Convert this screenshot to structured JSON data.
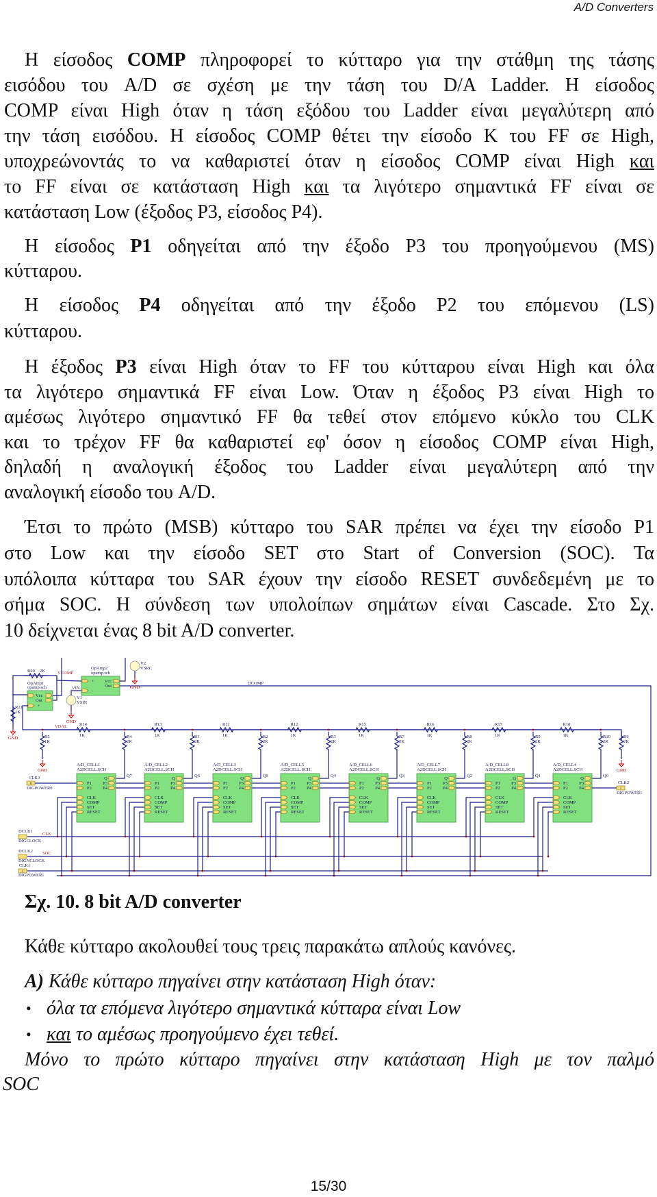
{
  "header": {
    "title": "A/D Converters"
  },
  "body": [
    {
      "lines": [
        [
          {
            "t": "Η είσοδος "
          },
          {
            "t": "COMP",
            "bold": true
          },
          {
            "t": " πληροφορεί το κύτταρο για την στάθμη της τάσης"
          }
        ],
        [
          {
            "t": "εισόδου του A/D σε σχέση με την τάση του D/A Ladder. Η είσοδος"
          }
        ],
        [
          {
            "t": "COMP είναι High όταν η τάση εξόδου του Ladder είναι μεγαλύτερη από"
          }
        ],
        [
          {
            "t": "την τάση εισόδου. Η είσοδος COMP θέτει την είσοδο K του FF σε High,"
          }
        ],
        [
          {
            "t": "υποχρεώνοντάς το να καθαριστεί όταν η είσοδος COMP είναι High "
          },
          {
            "t": "και",
            "underline": true
          }
        ],
        [
          {
            "t": "το FF είναι σε κατάσταση High "
          },
          {
            "t": "και",
            "underline": true
          },
          {
            "t": " τα λιγότερο σημαντικά FF είναι σε"
          }
        ],
        [
          {
            "t": "κατάσταση Low (έξοδος P3, είσοδος P4)."
          }
        ]
      ]
    },
    {
      "lines": [
        [
          {
            "t": "Η είσοδος "
          },
          {
            "t": "P1",
            "bold": true
          },
          {
            "t": " οδηγείται από την έξοδο P3 του προηγούμενου (MS)"
          }
        ],
        [
          {
            "t": "κύτταρου."
          }
        ]
      ]
    },
    {
      "lines": [
        [
          {
            "t": "Η είσοδος "
          },
          {
            "t": "P4",
            "bold": true
          },
          {
            "t": " οδηγείται από την έξοδο P2 του επόμενου (LS)"
          }
        ],
        [
          {
            "t": "κύτταρου."
          }
        ]
      ]
    },
    {
      "lines": [
        [
          {
            "t": "Η έξοδος "
          },
          {
            "t": "P3",
            "bold": true
          },
          {
            "t": " είναι High όταν το FF του κύτταρου είναι High και όλα"
          }
        ],
        [
          {
            "t": "τα λιγότερο σημαντικά FF είναι Low. Όταν η έξοδος P3 είναι High το"
          }
        ],
        [
          {
            "t": "αμέσως λιγότερο σημαντικό FF θα τεθεί στον επόμενο κύκλο του CLK"
          }
        ],
        [
          {
            "t": "και το τρέχον FF θα καθαριστεί εφ' όσον η είσοδος COMP είναι High,"
          }
        ],
        [
          {
            "t": "δηλαδή η αναλογική έξοδος του Ladder είναι μεγαλύτερη από την"
          }
        ],
        [
          {
            "t": "αναλογική είσοδο του A/D."
          }
        ]
      ]
    },
    {
      "lines": [
        [
          {
            "t": "Έτσι το πρώτο (MSB) κύτταρο του SAR πρέπει να έχει την είσοδο P1"
          }
        ],
        [
          {
            "t": "στο Low και την είσοδο SET στο Start of Conversion (SOC). Τα"
          }
        ],
        [
          {
            "t": "υπόλοιπα κύτταρα του SAR έχουν την είσοδο RESET συνδεδεμένη με το"
          }
        ],
        [
          {
            "t": "σήμα SOC. Η σύνδεση των υπολοίπων σημάτων είναι Cascade. Στο Σχ."
          }
        ],
        [
          {
            "t": "10 δείχνεται ένας 8 bit A/D converter."
          }
        ]
      ]
    },
    {
      "lines": [
        [
          {
            "t": "Σχ. 10. 8 bit A/D converter",
            "bold": true
          }
        ]
      ]
    },
    {
      "lines": [
        [
          {
            "t": "Κάθε κύτταρο ακολουθεί τους τρεις παρακάτω απλούς κανόνες."
          }
        ]
      ]
    },
    {
      "lines": [
        [
          {
            "t": "A)",
            "bold": true,
            "italic": true
          },
          {
            "t": " Κάθε κύτταρο πηγαίνει στην κατάσταση High όταν:",
            "italic": true
          }
        ]
      ]
    },
    {
      "lines": [
        [
          {
            "t": "όλα τα επόμενα λιγότερο σημαντικά κύτταρα είναι Low",
            "italic": true
          }
        ],
        [
          {
            "t": "και",
            "italic": true,
            "underline": true
          },
          {
            "t": " το αμέσως προηγούμενο έχει τεθεί.",
            "italic": true
          }
        ]
      ],
      "bullets": [
        "•",
        "•"
      ]
    },
    {
      "lines": [
        [
          {
            "t": "Μόνο το πρώτο κύτταρο πηγαίνει στην κατάσταση High με τον παλμό",
            "italic": true
          }
        ],
        [
          {
            "t": "SOC",
            "italic": true
          }
        ]
      ]
    }
  ],
  "schematic": {
    "colors": {
      "wire": "#1c1c8a",
      "cell_fill": "#82e07e",
      "cell_border": "#5aa85a",
      "pin_fill": "#f2e07a",
      "pin_border": "#8a6a10",
      "gnd": "#cc0000",
      "label": "#1c1c5a"
    },
    "opamp1": {
      "ref": "OpAmp1",
      "file": "opamp.sch",
      "pins": [
        "Vcc",
        "Out",
        "+"
      ]
    },
    "opamp2": {
      "ref": "OpAmp2",
      "file": "opamp.sch",
      "pins": [
        "+",
        "-",
        "Vcc",
        "Out"
      ]
    },
    "r20": {
      "ref": "R20",
      "value": "2K"
    },
    "r21": {
      "ref": "R21",
      "value": "1K"
    },
    "v1": {
      "ref": "V1",
      "type": "VSIN"
    },
    "v2": {
      "ref": "V2",
      "type": "VSRC"
    },
    "gnd": "GND",
    "nets": {
      "vcomp": "VCOMP",
      "vin": "VIN",
      "dcomp": "DCOMP",
      "vdal": "VDAL",
      "clk": "CLK",
      "soc": "SOC"
    },
    "r5": {
      "ref": "R5",
      "value": "1K"
    },
    "r6": {
      "ref": "R6",
      "value": "2K"
    },
    "ladder_series": [
      {
        "ref": "R14",
        "value": "1K"
      },
      {
        "ref": "R13",
        "value": "1K"
      },
      {
        "ref": "R11",
        "value": "1K"
      },
      {
        "ref": "R12",
        "value": "1K"
      },
      {
        "ref": "R15",
        "value": "1K"
      },
      {
        "ref": "R16",
        "value": "1K"
      },
      {
        "ref": "R17",
        "value": "1K"
      },
      {
        "ref": "R18",
        "value": "1K"
      }
    ],
    "ladder_shunt": [
      {
        "ref": "R4",
        "value": "2K"
      },
      {
        "ref": "R1",
        "value": "2K"
      },
      {
        "ref": "R2",
        "value": "2K"
      },
      {
        "ref": "R3",
        "value": "2K"
      },
      {
        "ref": "R7",
        "value": "2K"
      },
      {
        "ref": "R8",
        "value": "2K"
      },
      {
        "ref": "R9",
        "value": "2K"
      },
      {
        "ref": "R10",
        "value": "2K"
      }
    ],
    "cells": [
      {
        "name": "A/D_CELL1",
        "file": "A2DCELL.SCH",
        "q": "Q7"
      },
      {
        "name": "A/D_CELL2",
        "file": "A2DCELL.SCH",
        "q": "Q6"
      },
      {
        "name": "A/D_CELL3",
        "file": "A2DCELL.SCH",
        "q": "Q5"
      },
      {
        "name": "A/D_CELL5",
        "file": "A2DCELL.SCH",
        "q": "Q4"
      },
      {
        "name": "A/D_CELL6",
        "file": "A2DCELL.SCH",
        "q": "Q3"
      },
      {
        "name": "A/D_CELL7",
        "file": "A2DCELL.SCH",
        "q": "Q2"
      },
      {
        "name": "A/D_CELL8",
        "file": "A2DCELL.SCH",
        "q": "Q1"
      },
      {
        "name": "A/D_CELL4",
        "file": "A2DCELL.SCH",
        "q": "Q0"
      }
    ],
    "cell_pins": {
      "left": [
        "P1",
        "P2",
        "CLK",
        "COMP",
        "SET",
        "RESET"
      ],
      "right": [
        "Q",
        "P3",
        "P4"
      ]
    },
    "sources": {
      "clk3": {
        "ref": "CLK3",
        "value": "0",
        "type": "DIGPOWER0"
      },
      "dclk1": {
        "ref": "DCLK1",
        "type": "DIGCLOCK"
      },
      "dclk2": {
        "ref": "DCLK2",
        "type": "DIGNCLOCK"
      },
      "clk1": {
        "ref": "CLK1",
        "value": "1",
        "type": "DIGPOWER1"
      },
      "clk2": {
        "ref": "CLK2",
        "value": "1",
        "type": "DIGPOWER1"
      }
    }
  },
  "footer": {
    "page": "15/30"
  }
}
